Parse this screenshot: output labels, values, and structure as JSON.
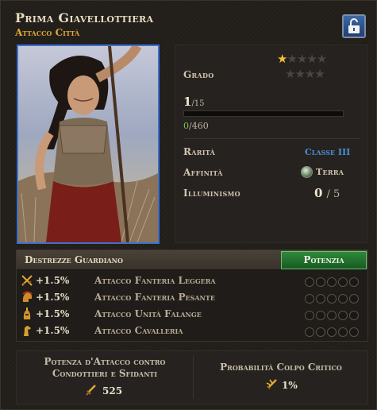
{
  "header": {
    "title": "Prima Giavellottiera",
    "subtitle": "Attacco Città",
    "lock_icon": "unlock-icon"
  },
  "stats": {
    "grado_label": "Grado",
    "grado_stars_filled": 1,
    "grado_stars_total": 9,
    "level": "1",
    "level_max": "/15",
    "xp_current": "0",
    "xp_max": "/460",
    "rarita_label": "Rarità",
    "rarita_value": "Classe III",
    "affinita_label": "Affinità",
    "affinita_value": "Terra",
    "illuminismo_label": "Illuminismo",
    "illuminismo_value": "0",
    "illuminismo_max": "/ 5"
  },
  "guardian": {
    "title": "Destrezze Guardiano",
    "button_label": "Potenzia",
    "skills": [
      {
        "icon": "swords-icon",
        "pct": "+1.5%",
        "name": "Attacco Fanteria Leggera"
      },
      {
        "icon": "spartan-helmet-icon",
        "pct": "+1.5%",
        "name": "Attacco Fanteria Pesante"
      },
      {
        "icon": "phalanx-helmet-icon",
        "pct": "+1.5%",
        "name": "Attacco Unità Falange"
      },
      {
        "icon": "horse-icon",
        "pct": "+1.5%",
        "name": "Attacco Cavalleria"
      }
    ]
  },
  "bottom": {
    "left_title_line1": "Potenza d'Attacco contro",
    "left_title_line2": "Condottieri e Sfidanti",
    "left_value": "525",
    "right_title": "Probabilità Colpo Critico",
    "right_value": "1%"
  },
  "colors": {
    "accent_gold": "#e0a830",
    "class_blue": "#4c8ed8",
    "xp_green": "#7cc44a",
    "button_green": "#2e8a3a"
  }
}
